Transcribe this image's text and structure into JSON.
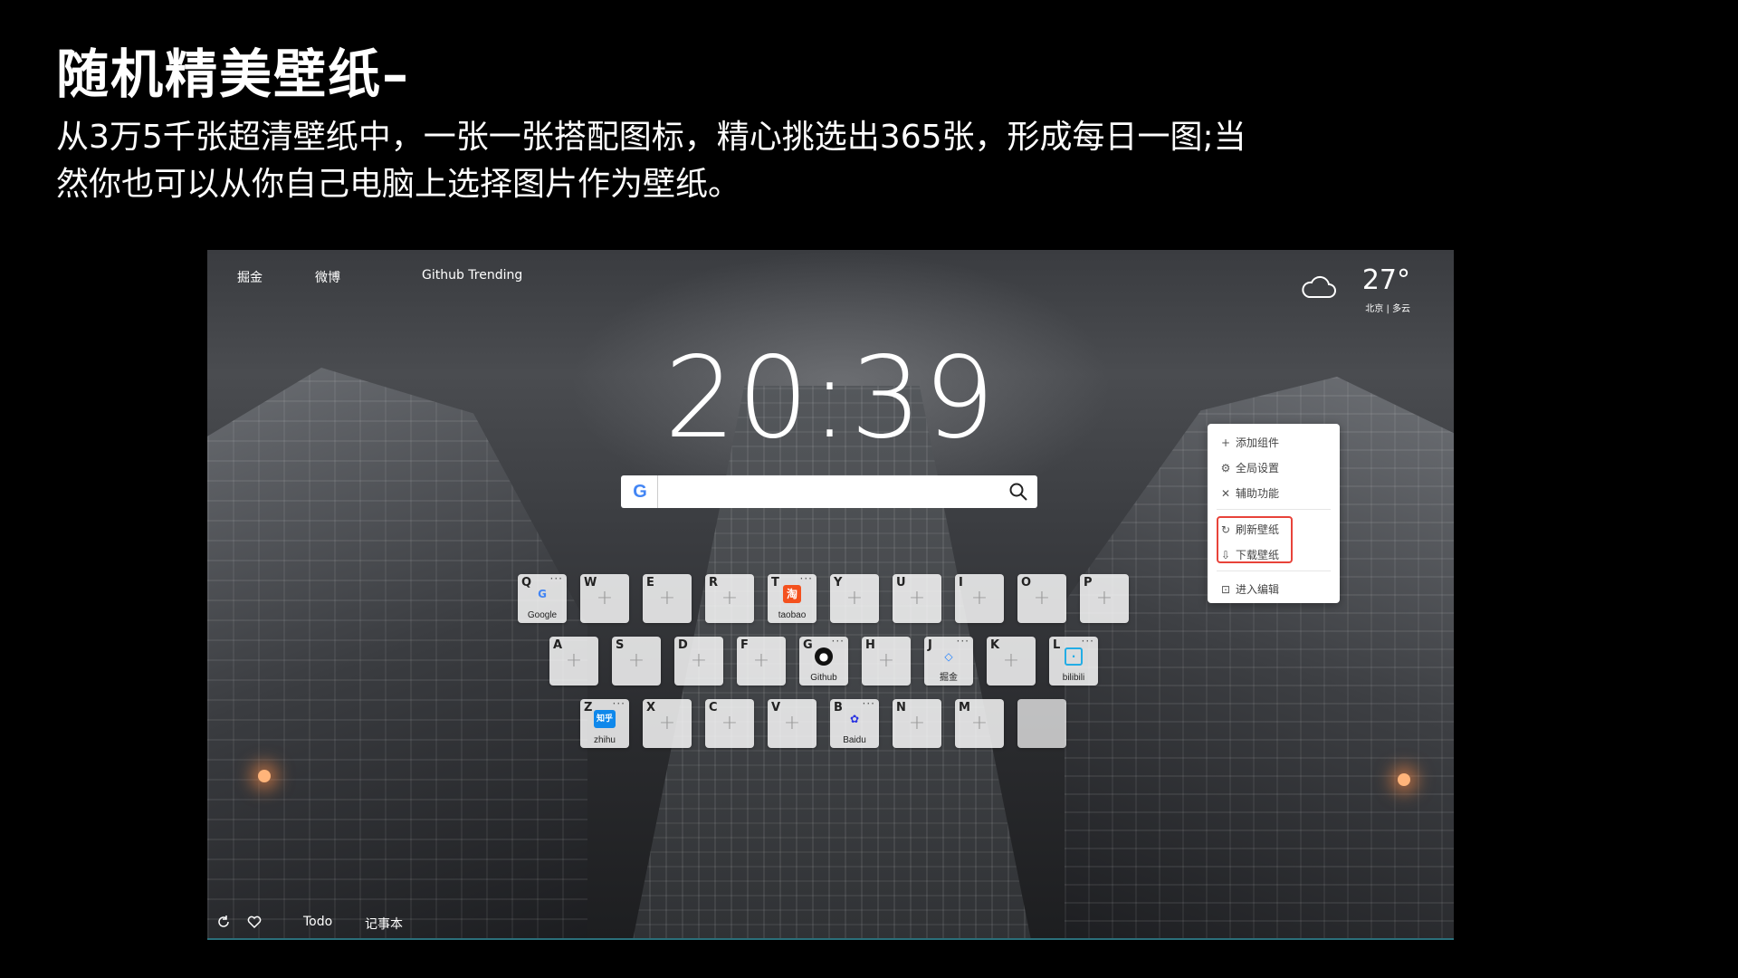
{
  "slide": {
    "title": "随机精美壁纸–",
    "description": " 从3万5千张超清壁纸中，一张一张搭配图标，精心挑选出365张，形成每日一图;当然你也可以从你自己电脑上选择图片作为壁纸。"
  },
  "nav": {
    "items": [
      "掘金",
      "微博",
      "Github Trending"
    ]
  },
  "weather": {
    "temp": "27°",
    "location": "北京 | 多云",
    "icon": "cloud-icon"
  },
  "clock": {
    "time": "20:39"
  },
  "search": {
    "placeholder": "",
    "engine_icon": "google-icon",
    "search_icon": "search-icon"
  },
  "tiles": {
    "row1": [
      {
        "key": "Q",
        "label": "Google",
        "icon": "google-icon"
      },
      {
        "key": "W",
        "label": ""
      },
      {
        "key": "E",
        "label": ""
      },
      {
        "key": "R",
        "label": ""
      },
      {
        "key": "T",
        "label": "taobao",
        "icon": "taobao-icon",
        "glyph": "淘"
      },
      {
        "key": "Y",
        "label": ""
      },
      {
        "key": "U",
        "label": ""
      },
      {
        "key": "I",
        "label": ""
      },
      {
        "key": "O",
        "label": ""
      },
      {
        "key": "P",
        "label": ""
      }
    ],
    "row2": [
      {
        "key": "A",
        "label": ""
      },
      {
        "key": "S",
        "label": ""
      },
      {
        "key": "D",
        "label": ""
      },
      {
        "key": "F",
        "label": ""
      },
      {
        "key": "G",
        "label": "Github",
        "icon": "github-icon"
      },
      {
        "key": "H",
        "label": ""
      },
      {
        "key": "J",
        "label": "掘金",
        "icon": "juejin-icon"
      },
      {
        "key": "K",
        "label": ""
      },
      {
        "key": "L",
        "label": "bilibili",
        "icon": "bilibili-icon"
      }
    ],
    "row3": [
      {
        "key": "Z",
        "label": "zhihu",
        "icon": "zhihu-icon",
        "glyph": "知乎"
      },
      {
        "key": "X",
        "label": ""
      },
      {
        "key": "C",
        "label": ""
      },
      {
        "key": "V",
        "label": ""
      },
      {
        "key": "B",
        "label": "Baidu",
        "icon": "baidu-icon"
      },
      {
        "key": "N",
        "label": ""
      },
      {
        "key": "M",
        "label": ""
      },
      {
        "key": "",
        "label": ""
      }
    ],
    "more": "···",
    "plus": "+"
  },
  "context_menu": {
    "items": [
      {
        "label": "添加组件",
        "icon": "plus-icon"
      },
      {
        "label": "全局设置",
        "icon": "gear-icon"
      },
      {
        "label": "辅助功能",
        "icon": "tools-icon"
      },
      {
        "label": "刷新壁纸",
        "icon": "refresh-icon"
      },
      {
        "label": "下载壁纸",
        "icon": "download-icon"
      },
      {
        "label": "进入编辑",
        "icon": "unlock-icon"
      }
    ],
    "highlight_color": "#e8433a"
  },
  "bottom": {
    "items": [
      "Todo",
      "记事本"
    ],
    "icons": [
      "refresh-icon",
      "heart-icon"
    ]
  }
}
